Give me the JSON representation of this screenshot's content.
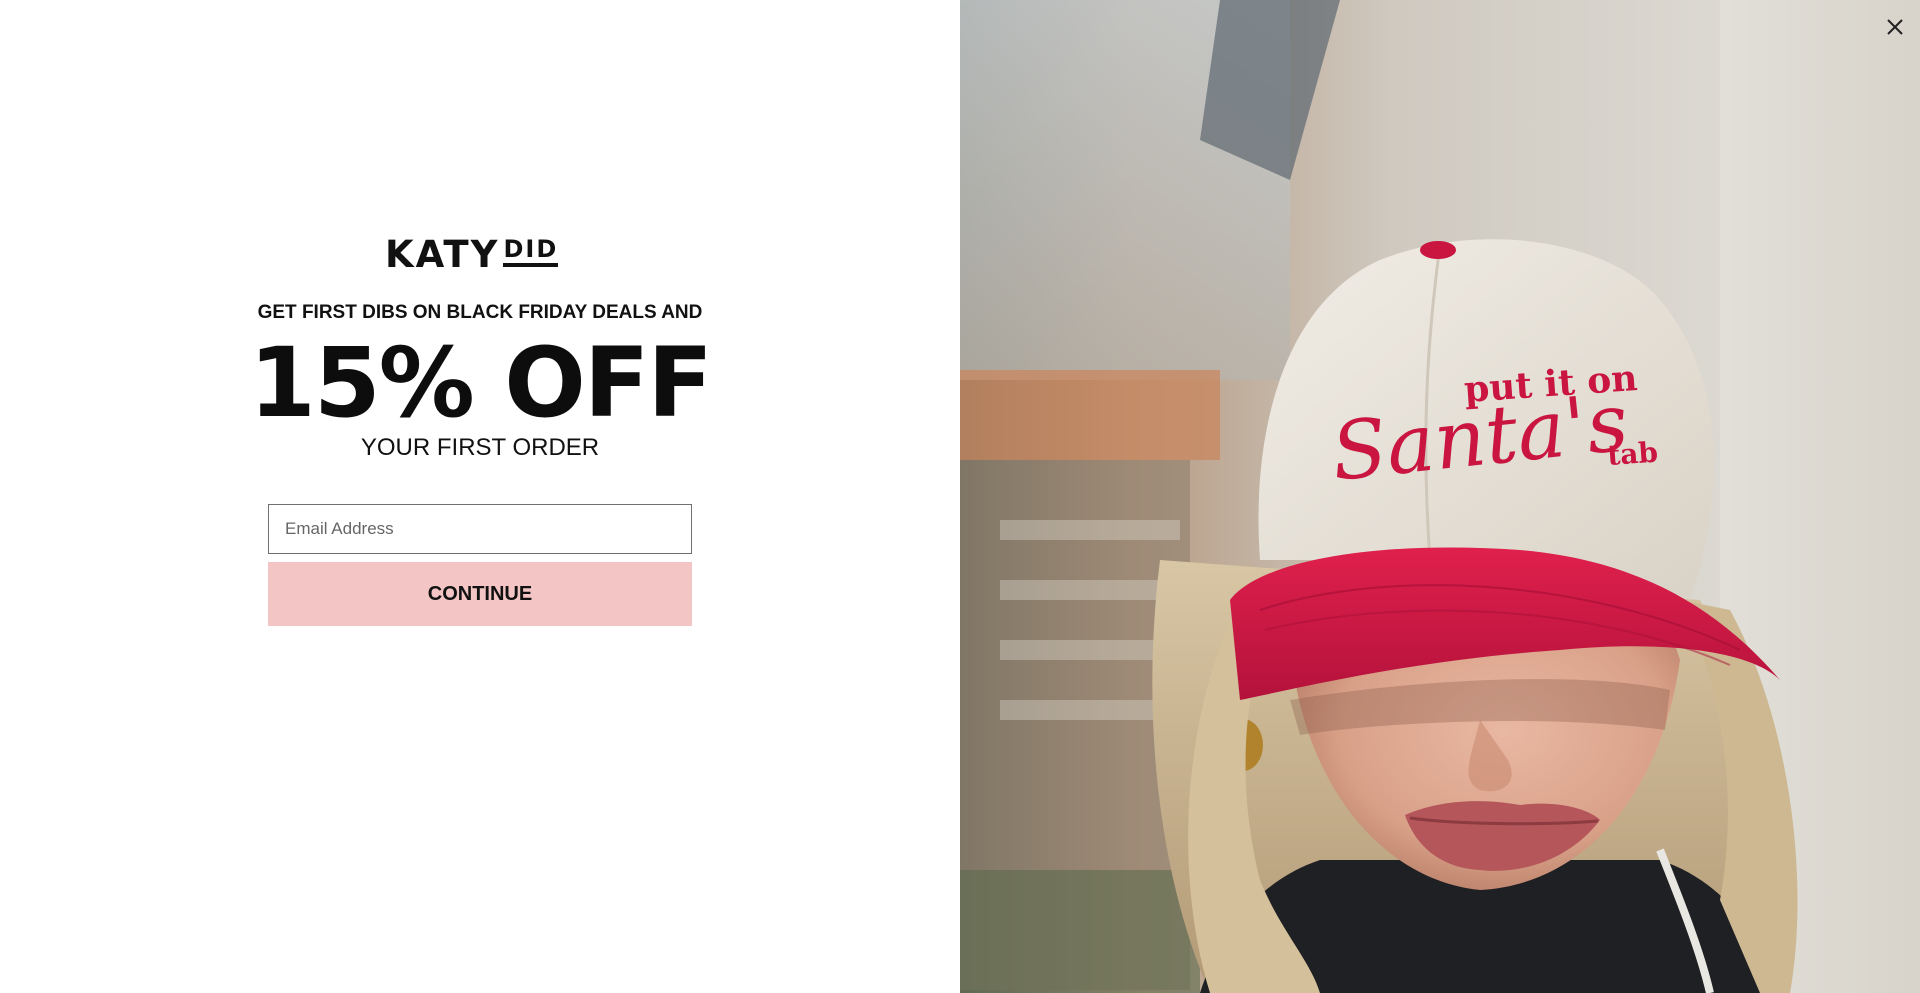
{
  "popup": {
    "logo_text": "KATY",
    "logo_sub": "DID",
    "eyebrow": "GET FIRST DIBS ON BLACK FRIDAY DEALS AND",
    "headline": "15% OFF",
    "subline": "YOUR FIRST ORDER",
    "email_placeholder": "Email Address",
    "email_value": "",
    "continue_label": "CONTINUE"
  },
  "photo": {
    "cap_line1": "put it on",
    "cap_line2": "Santa's",
    "cap_line3": "tab"
  },
  "colors": {
    "button_bg": "#f3c6c5",
    "cap_red": "#d51945",
    "cap_crown": "#ebe6de"
  },
  "icons": {
    "close": "close-icon"
  }
}
